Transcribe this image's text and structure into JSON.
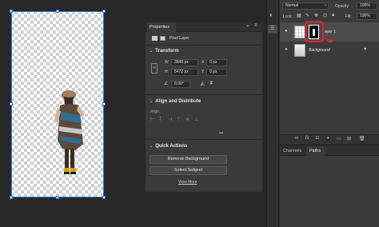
{
  "properties": {
    "title": "Properties",
    "layer_kind": "Pixel Layer",
    "transform": {
      "title": "Transform",
      "w_label": "W",
      "w_value": "3648 px",
      "h_label": "H",
      "h_value": "5472 px",
      "x_label": "X",
      "x_value": "0 px",
      "y_label": "Y",
      "y_value": "0 px",
      "angle_value": "0.00°"
    },
    "align": {
      "title": "Align and Distribute",
      "align_label": "Align:",
      "more": "•••"
    },
    "quick_actions": {
      "title": "Quick Actions",
      "remove_bg": "Remove Background",
      "select_subject": "Select Subject",
      "view_more": "View More"
    }
  },
  "layers": {
    "blend_mode": "Normal",
    "opacity_label": "Opacity:",
    "opacity_value": "100%",
    "lock_label": "Lock:",
    "fill_label": "Fill:",
    "fill_value": "100%",
    "layer1_name": "ayer 1",
    "background_name": "Background"
  },
  "bottom_tabs": {
    "channels": "Channels",
    "paths": "Paths"
  },
  "colors": {
    "annotation": "#e0232b",
    "selection": "#2d7be5"
  }
}
